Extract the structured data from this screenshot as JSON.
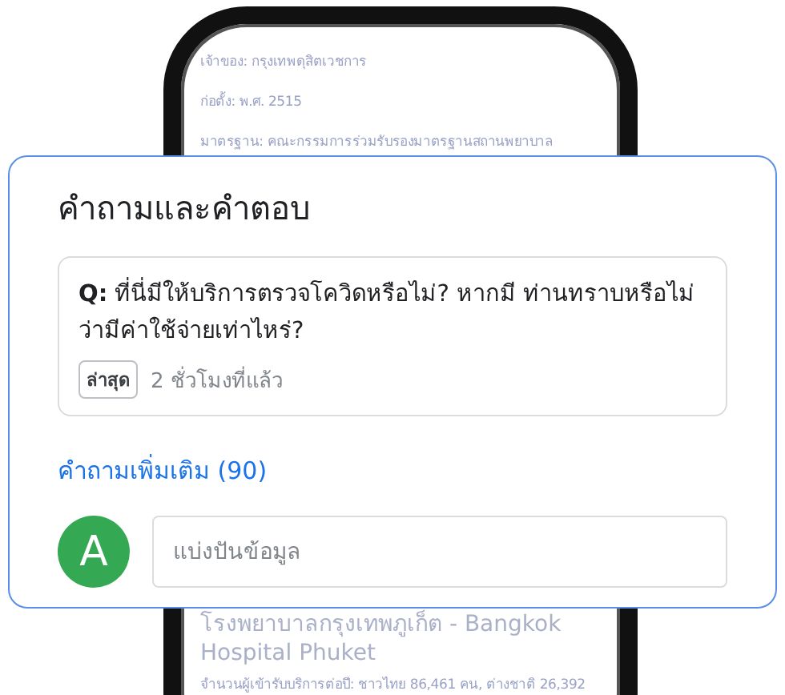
{
  "phone": {
    "top_lines": [
      "เจ้าของ: กรุงเทพดุสิตเวชการ",
      "ก่อตั้ง: พ.ศ. 2515",
      "มาตรฐาน: คณะกรรมการร่วมรับรองมาตรฐานสถานพยาบาล"
    ],
    "place_title": "โรงพยาบาลกรุงเทพภูเก็ต - Bangkok Hospital Phuket",
    "place_description": "จำนวนผู้เข้ารับบริการต่อปี: ชาวไทย 86,461 คน, ต่างชาติ 26,392"
  },
  "card": {
    "title": "คำถามและคำตอบ",
    "question": {
      "prefix": "Q:",
      "text": "ที่นี่มีให้บริการตรวจโควิดหรือไม่? หากมี ท่านทราบหรือไม่ว่ามีค่าใช้จ่ายเท่าไหร่?",
      "tag": "ล่าสุด",
      "time": "2 ชั่วโมงที่แล้ว"
    },
    "more_link": "คำถามเพิ่มเติม (90)",
    "avatar": {
      "letter": "A",
      "color": "#34a853"
    },
    "input": {
      "placeholder": "แบ่งปันข้อมูล"
    }
  }
}
